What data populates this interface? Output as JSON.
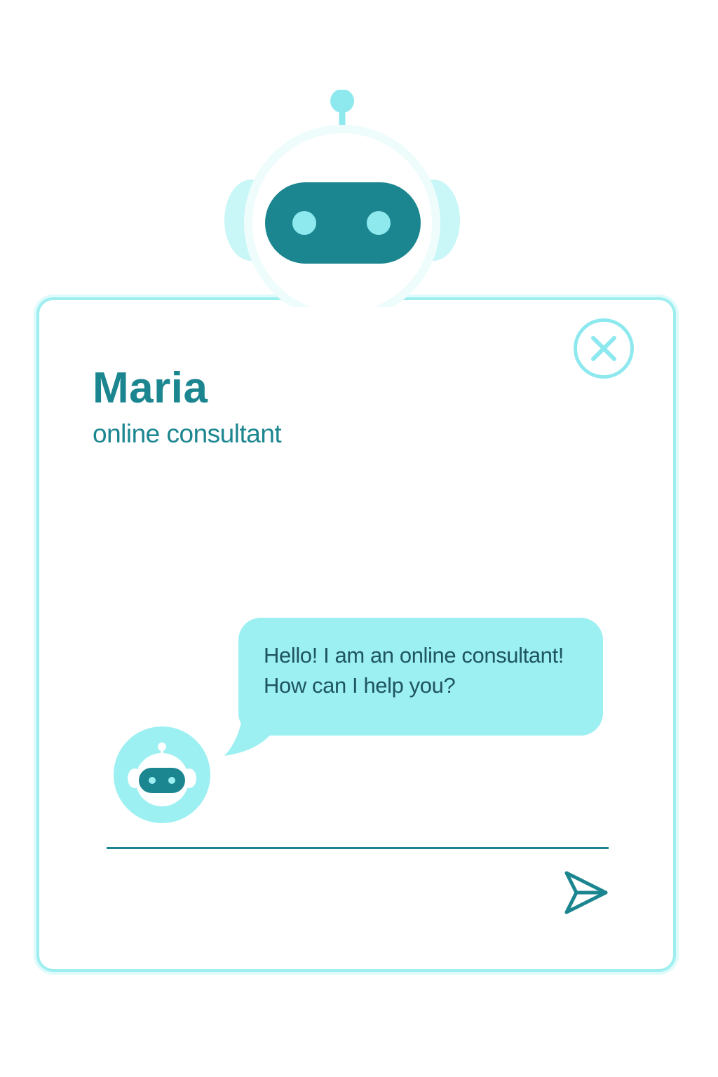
{
  "agent": {
    "name": "Maria",
    "role": "online consultant"
  },
  "chat": {
    "messages": [
      {
        "sender": "bot",
        "lines": [
          "Hello! I am an online consultant!",
          "How can I help you?"
        ]
      }
    ],
    "input": {
      "value": "",
      "placeholder": ""
    }
  },
  "icons": {
    "header": "robot-icon",
    "close": "close-icon",
    "avatar": "robot-avatar-icon",
    "send": "send-icon"
  },
  "colors": {
    "accent_dark": "#1c8690",
    "accent_light": "#9cf0f2",
    "border": "#9eeef0",
    "text_dark": "#1f5560",
    "background": "#ffffff"
  }
}
